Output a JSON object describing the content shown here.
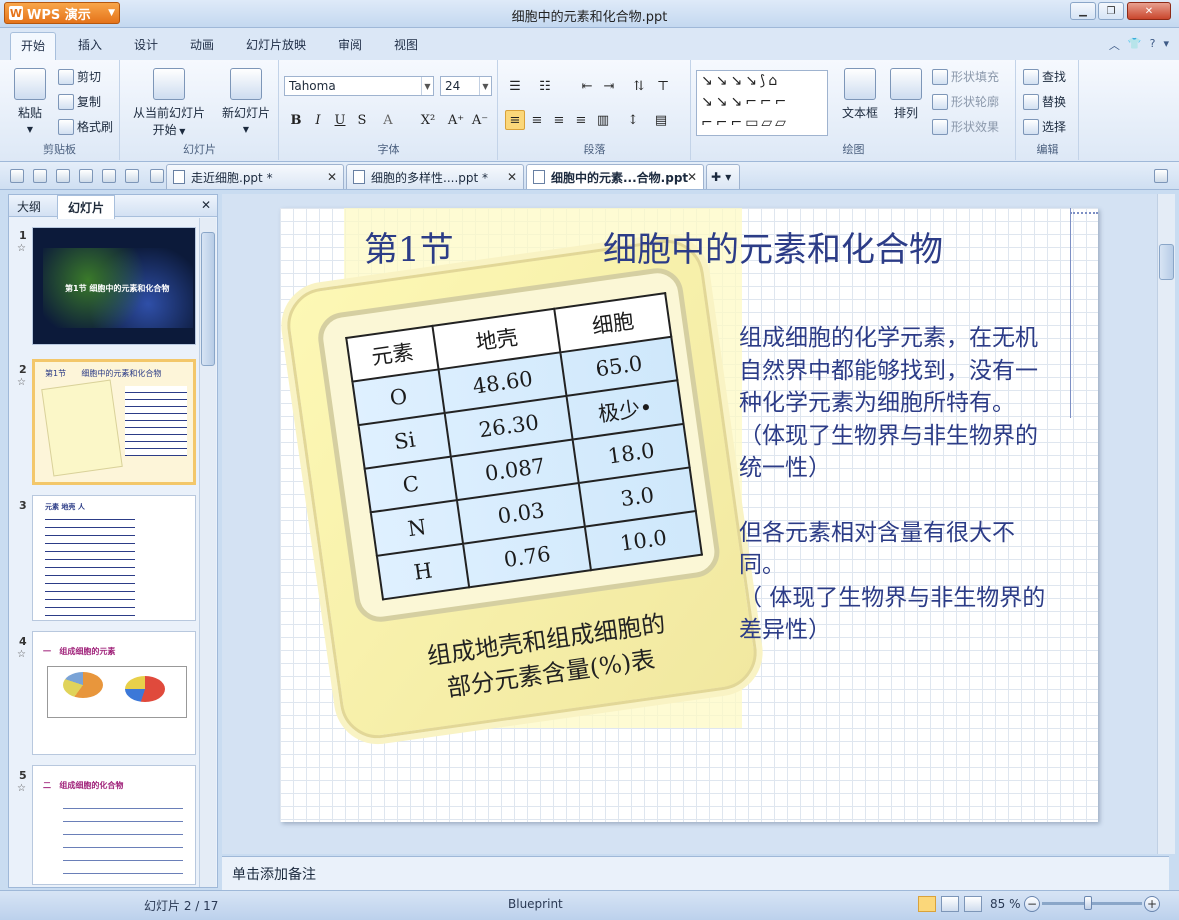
{
  "app": {
    "name": "WPS 演示",
    "window_title": "细胞中的元素和化合物.ppt"
  },
  "ribbon_tabs": [
    "开始",
    "插入",
    "设计",
    "动画",
    "幻灯片放映",
    "审阅",
    "视图"
  ],
  "ribbon": {
    "clipboard": {
      "paste": "粘贴",
      "cut": "剪切",
      "copy": "复制",
      "format_painter": "格式刷",
      "label": "剪贴板"
    },
    "slides": {
      "from_current": "从当前幻灯片",
      "start": "开始",
      "new_slide": "新幻灯片",
      "label": "幻灯片"
    },
    "font": {
      "name": "Tahoma",
      "size": "24",
      "label": "字体"
    },
    "paragraph": {
      "label": "段落"
    },
    "drawing": {
      "textbox": "文本框",
      "arrange": "排列",
      "shape_fill": "形状填充",
      "shape_outline": "形状轮廓",
      "shape_effect": "形状效果",
      "label": "绘图"
    },
    "editing": {
      "find": "查找",
      "replace": "替换",
      "select": "选择",
      "label": "编辑"
    }
  },
  "doc_tabs": [
    {
      "name": "走近细胞.ppt *"
    },
    {
      "name": "细胞的多样性....ppt *"
    },
    {
      "name": "细胞中的元素...合物.ppt"
    }
  ],
  "left_panel": {
    "tab_outline": "大纲",
    "tab_slides": "幻灯片"
  },
  "thumbnails": [
    {
      "num": "1",
      "title": "第1节 细胞中的元素和化合物"
    },
    {
      "num": "2",
      "title": "第1节      细胞中的元素和化合物"
    },
    {
      "num": "3",
      "title": "元素  地壳  人"
    },
    {
      "num": "4",
      "title": "一   组成细胞的元素"
    },
    {
      "num": "5",
      "title": "二   组成细胞的化合物"
    }
  ],
  "slide": {
    "title_left": "第1节",
    "title_right": "细胞中的元素和化合物",
    "body": [
      "组成细胞的化学元素，在无机自然界中都能够找到，没有一种化学元素为细胞所特有。",
      "（体现了生物界与非生物界的统一性）",
      "",
      "但各元素相对含量有很大不同。",
      "（ 体现了生物界与非生物界的差异性）"
    ],
    "table": {
      "headers": [
        "元素",
        "地壳",
        "细胞"
      ],
      "rows": [
        [
          "O",
          "48.60",
          "65.0"
        ],
        [
          "Si",
          "26.30",
          "极少•"
        ],
        [
          "C",
          "0.087",
          "18.0"
        ],
        [
          "N",
          "0.03",
          "3.0"
        ],
        [
          "H",
          "0.76",
          "10.0"
        ]
      ],
      "caption_line1": "组成地壳和组成细胞的",
      "caption_line2": "部分元素含量(%)表"
    }
  },
  "notes_placeholder": "单击添加备注",
  "status": {
    "slide_indicator": "幻灯片 2 / 17",
    "theme": "Blueprint",
    "zoom": "85 %"
  }
}
